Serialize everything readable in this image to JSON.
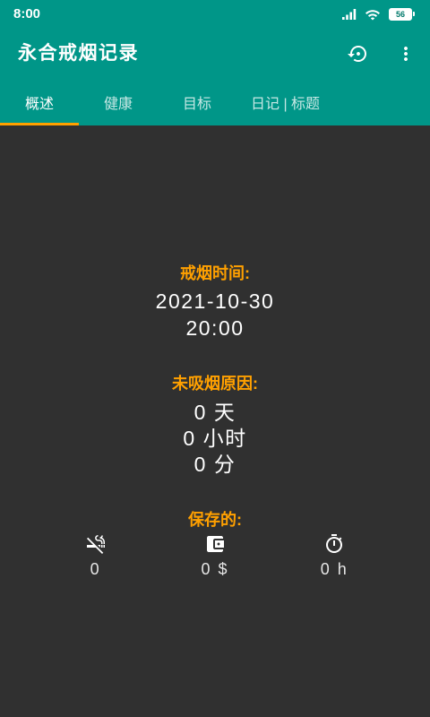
{
  "status_bar": {
    "time": "8:00",
    "battery": "56",
    "icons": [
      "signal-icon",
      "wifi-icon",
      "battery-icon"
    ]
  },
  "app_bar": {
    "title": "永合戒烟记录",
    "actions": [
      {
        "icon": "settings-backup-restore-icon"
      },
      {
        "icon": "more-vert-icon"
      }
    ]
  },
  "tabs": [
    {
      "label": "概述",
      "selected": true
    },
    {
      "label": "健康",
      "selected": false
    },
    {
      "label": "目标",
      "selected": false
    },
    {
      "label": "日记 | 标题",
      "selected": false
    }
  ],
  "overview": {
    "quit_time": {
      "label": "戒烟时间:",
      "date": "2021-10-30",
      "time": "20:00"
    },
    "smoke_free": {
      "label": "未吸烟原因:",
      "days": "0 天",
      "hours": "0 小时",
      "minutes": "0 分"
    },
    "saved": {
      "label": "保存的:",
      "items": [
        {
          "icon": "smoke-free-icon",
          "value": "0"
        },
        {
          "icon": "wallet-icon",
          "value": "0 $"
        },
        {
          "icon": "timer-icon",
          "value": "0 h"
        }
      ]
    }
  },
  "colors": {
    "primary": "#009688",
    "accent": "#FFA000",
    "background": "#303030",
    "text": "#FFFFFF"
  }
}
